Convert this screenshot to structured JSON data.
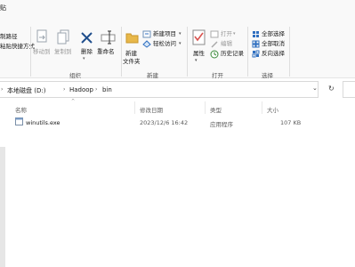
{
  "ribbon": {
    "clipboard_partial": {
      "line1": "贴",
      "line2": "制路径",
      "line3": "粘贴快捷方式"
    },
    "organize": {
      "move_to": "移动到",
      "copy_to": "复制到",
      "delete": "删除",
      "rename": "重命名",
      "group_label": "组织"
    },
    "new": {
      "new_folder_line1": "新建",
      "new_folder_line2": "文件夹",
      "new_item": "新建项目",
      "easy_access": "轻松访问",
      "group_label": "新建"
    },
    "open": {
      "properties": "属性",
      "open": "打开",
      "edit": "编辑",
      "history": "历史记录",
      "group_label": "打开"
    },
    "select": {
      "select_all": "全部选择",
      "select_none": "全部取消",
      "invert": "反向选择",
      "group_label": "选择"
    }
  },
  "address": {
    "crumbs": [
      "本地磁盘 (D:)",
      "Hadoop",
      "bin"
    ]
  },
  "columns": {
    "name": "名称",
    "modified": "修改日期",
    "type": "类型",
    "size": "大小"
  },
  "files": [
    {
      "name": "winutils.exe",
      "modified": "2023/12/6 16:42",
      "type": "应用程序",
      "size": "107 KB"
    }
  ],
  "colors": {
    "folder": "#e8b84a",
    "accent_blue": "#2f6fc0",
    "delete_blue": "#1f4e8c",
    "check_red": "#d9534f"
  }
}
